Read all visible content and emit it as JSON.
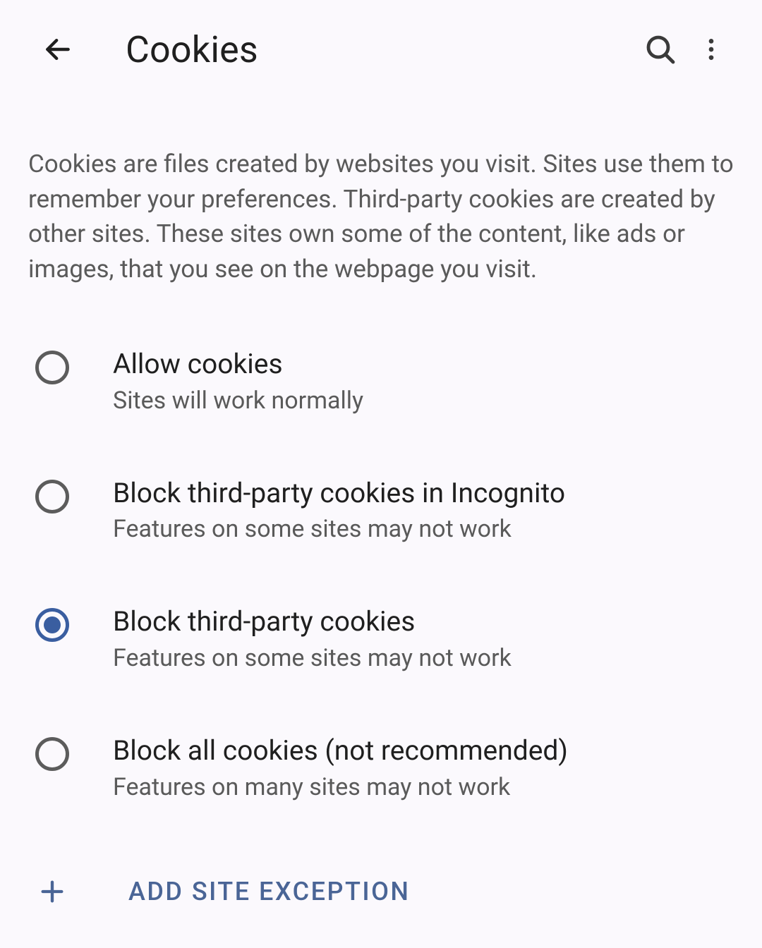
{
  "header": {
    "title": "Cookies"
  },
  "description": "Cookies are files created by websites you visit. Sites use them to remember your preferences. Third-party cookies are created by other sites. These sites own some of the content, like ads or images, that you see on the webpage you visit.",
  "options": [
    {
      "title": "Allow cookies",
      "subtitle": "Sites will work normally",
      "selected": false
    },
    {
      "title": "Block third-party cookies in Incognito",
      "subtitle": "Features on some sites may not work",
      "selected": false
    },
    {
      "title": "Block third-party cookies",
      "subtitle": "Features on some sites may not work",
      "selected": true
    },
    {
      "title": "Block all cookies (not recommended)",
      "subtitle": "Features on many sites may not work",
      "selected": false
    }
  ],
  "add_exception": {
    "label": "ADD SITE EXCEPTION"
  },
  "colors": {
    "accent": "#3a5ea0",
    "link": "#4a6596",
    "text": "#1f1f1f",
    "secondary_text": "#5a5a5a",
    "background": "#fbf9fd"
  }
}
